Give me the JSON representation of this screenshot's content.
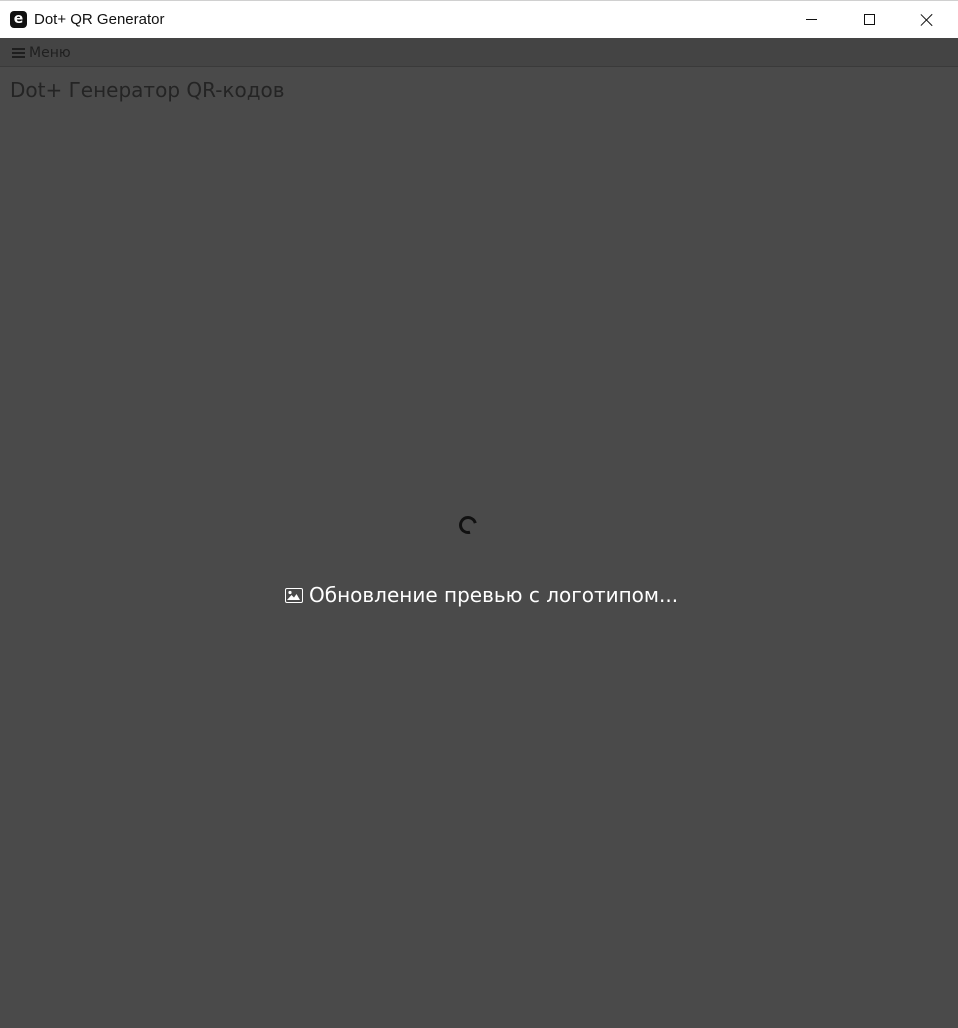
{
  "window": {
    "title": "Dot+ QR Generator",
    "app_icon_glyph": "e",
    "controls": {
      "minimize": "minimize-icon",
      "maximize": "maximize-icon",
      "close": "close-icon"
    }
  },
  "menubar": {
    "menu_label": "Меню",
    "menu_icon": "hamburger-icon"
  },
  "main": {
    "page_title": "Dot+ Генератор QR-кодов",
    "loading": {
      "spinner_icon": "spinner-icon",
      "status_icon": "image-icon",
      "status_text": "Обновление превью с логотипом..."
    }
  },
  "colors": {
    "background": "#4a4a4a",
    "titlebar": "#ffffff",
    "status_text": "#ffffff"
  }
}
